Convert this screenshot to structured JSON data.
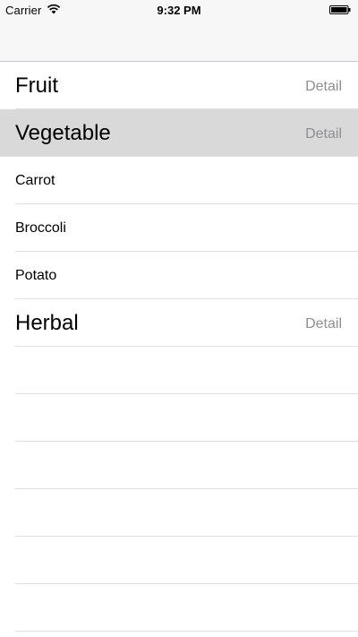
{
  "status_bar": {
    "carrier": "Carrier",
    "time": "9:32 PM",
    "wifi_icon": "wifi-icon",
    "battery_icon": "battery-icon"
  },
  "table": {
    "rows": [
      {
        "kind": "header",
        "title": "Fruit",
        "detail": "Detail",
        "selected": false
      },
      {
        "kind": "header",
        "title": "Vegetable",
        "detail": "Detail",
        "selected": true
      },
      {
        "kind": "item",
        "title": "Carrot"
      },
      {
        "kind": "item",
        "title": "Broccoli"
      },
      {
        "kind": "item",
        "title": "Potato"
      },
      {
        "kind": "header",
        "title": "Herbal",
        "detail": "Detail",
        "selected": false
      }
    ]
  },
  "colors": {
    "selected_row": "#d9d9d9",
    "detail_text": "#8e8e93",
    "nav_background": "#f7f7f7",
    "separator": "#e0e0e3"
  }
}
